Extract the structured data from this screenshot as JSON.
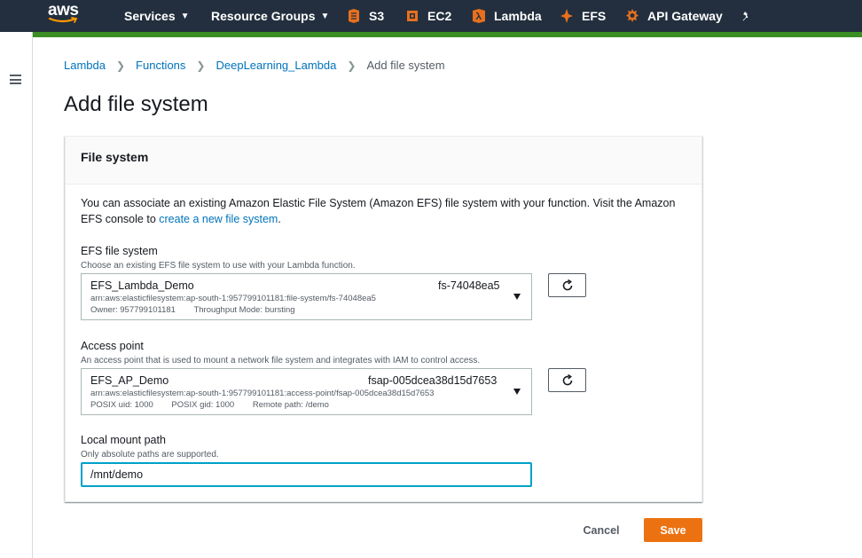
{
  "nav": {
    "logo_text": "aws",
    "services_label": "Services",
    "resource_groups_label": "Resource Groups",
    "shortcuts": [
      {
        "label": "S3",
        "icon": "s3-icon",
        "color": "#e7701e"
      },
      {
        "label": "EC2",
        "icon": "ec2-icon",
        "color": "#e7701e"
      },
      {
        "label": "Lambda",
        "icon": "lambda-icon",
        "color": "#e7701e"
      },
      {
        "label": "EFS",
        "icon": "efs-icon",
        "color": "#e7701e"
      },
      {
        "label": "API Gateway",
        "icon": "api-gateway-icon",
        "color": "#e7701e"
      }
    ],
    "pin_icon": "pushpin-icon",
    "accent_bar_color": "#3a8e23"
  },
  "breadcrumb": {
    "items": [
      "Lambda",
      "Functions",
      "DeepLearning_Lambda"
    ],
    "current": "Add file system"
  },
  "page_title": "Add file system",
  "panel": {
    "title": "File system",
    "intro_text": "You can associate an existing Amazon Elastic File System (Amazon EFS) file system with your function. Visit the Amazon EFS console to ",
    "intro_link": "create a new file system",
    "intro_end": ".",
    "efs": {
      "label": "EFS file system",
      "description": "Choose an existing EFS file system to use with your Lambda function.",
      "selected_name": "EFS_Lambda_Demo",
      "selected_id": "fs-74048ea5",
      "arn": "arn:aws:elasticfilesystem:ap-south-1:957799101181:file-system/fs-74048ea5",
      "owner": "Owner: 957799101181",
      "throughput": "Throughput Mode: bursting"
    },
    "access_point": {
      "label": "Access point",
      "description": "An access point that is used to mount a network file system and integrates with IAM to control access.",
      "selected_name": "EFS_AP_Demo",
      "selected_id": "fsap-005dcea38d15d7653",
      "arn": "arn:aws:elasticfilesystem:ap-south-1:957799101181:access-point/fsap-005dcea38d15d7653",
      "posix_uid": "POSIX uid: 1000",
      "posix_gid": "POSIX gid: 1000",
      "remote_path": "Remote path: /demo"
    },
    "mount": {
      "label": "Local mount path",
      "description": "Only absolute paths are supported.",
      "value": "/mnt/demo"
    }
  },
  "actions": {
    "cancel_label": "Cancel",
    "save_label": "Save",
    "save_color": "#ec7211"
  }
}
